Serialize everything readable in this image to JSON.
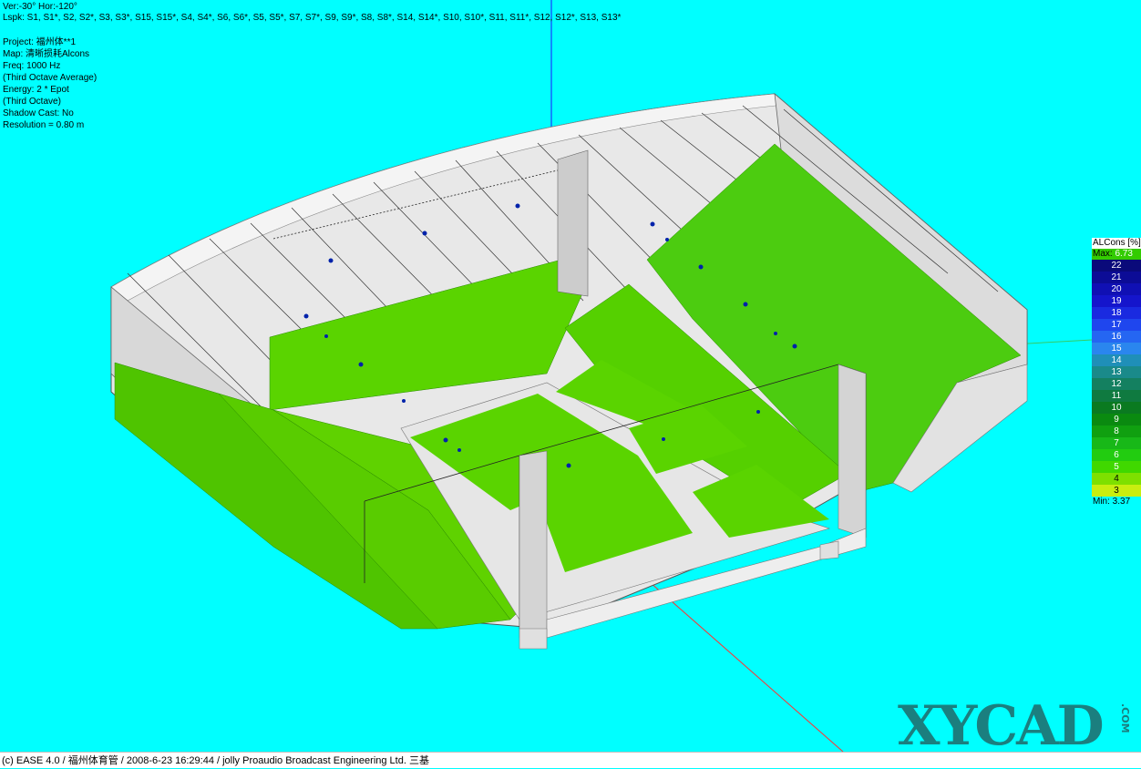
{
  "view": {
    "angles": "Ver:-30°   Hor:-120°",
    "loudspeakers": "Lspk: S1, S1*, S2, S2*, S3, S3*, S15, S15*, S4, S4*, S6, S6*, S5, S5*, S7, S7*, S9, S9*, S8, S8*, S14, S14*, S10, S10*, S11, S11*, S12, S12*, S13, S13*"
  },
  "info": {
    "project": "Project: 福州体**1",
    "map": "Map: 清晰损耗Alcons",
    "freq": "Freq: 1000 Hz",
    "avg": "(Third Octave Average)",
    "energy": "Energy: 2 * Epot",
    "octave": "(Third Octave)",
    "shadow": "Shadow Cast: No",
    "resolution": "Resolution =   0.80 m"
  },
  "legend": {
    "title": "ALCons [%]",
    "max_label": "Max:",
    "max_value": "6.73",
    "min_text": "Min:  3.37",
    "steps": [
      {
        "v": "22",
        "c": "#0a0a7a"
      },
      {
        "v": "21",
        "c": "#0c0c96"
      },
      {
        "v": "20",
        "c": "#1010b4"
      },
      {
        "v": "19",
        "c": "#1515cc"
      },
      {
        "v": "18",
        "c": "#1a2ae0"
      },
      {
        "v": "17",
        "c": "#1f46ee"
      },
      {
        "v": "16",
        "c": "#2566f2"
      },
      {
        "v": "15",
        "c": "#2a86ee"
      },
      {
        "v": "14",
        "c": "#1f8fb8"
      },
      {
        "v": "13",
        "c": "#1a8a8a"
      },
      {
        "v": "12",
        "c": "#148060"
      },
      {
        "v": "11",
        "c": "#0f7a40"
      },
      {
        "v": "10",
        "c": "#0a7a20"
      },
      {
        "v": "9",
        "c": "#0a8a10"
      },
      {
        "v": "8",
        "c": "#10a010"
      },
      {
        "v": "7",
        "c": "#18b818"
      },
      {
        "v": "6",
        "c": "#22cc10"
      },
      {
        "v": "5",
        "c": "#40d800"
      },
      {
        "v": "4",
        "c": "#7ee000"
      },
      {
        "v": "3",
        "c": "#c8ee10"
      }
    ]
  },
  "watermark": {
    "main": "XYCAD",
    "com": ".COM"
  },
  "status": "(c) EASE 4.0  / 福州体育管  / 2008-6-23 16:29:44 / jolly Proaudio Broadcast Engineering Ltd. 三基"
}
